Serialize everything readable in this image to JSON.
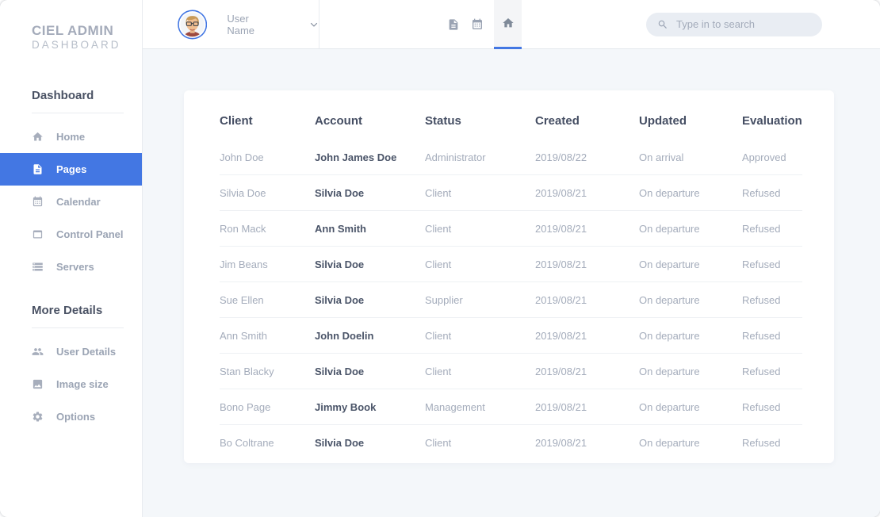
{
  "brand": {
    "line1": "CIEL ADMIN",
    "line2": "DASHBOARD"
  },
  "sidebar": {
    "sections": [
      {
        "heading": "Dashboard",
        "items": [
          {
            "label": "Home",
            "icon": "home-icon",
            "active": false
          },
          {
            "label": "Pages",
            "icon": "pages-icon",
            "active": true
          },
          {
            "label": "Calendar",
            "icon": "calendar-icon",
            "active": false
          },
          {
            "label": "Control Panel",
            "icon": "control-panel-icon",
            "active": false
          },
          {
            "label": "Servers",
            "icon": "servers-icon",
            "active": false
          }
        ]
      },
      {
        "heading": "More Details",
        "items": [
          {
            "label": "User Details",
            "icon": "user-details-icon",
            "active": false
          },
          {
            "label": "Image size",
            "icon": "image-size-icon",
            "active": false
          },
          {
            "label": "Options",
            "icon": "gear-icon",
            "active": false
          }
        ]
      }
    ]
  },
  "topbar": {
    "user": {
      "name": "User Name"
    },
    "tabs": [
      {
        "icon": "document-icon",
        "active": false
      },
      {
        "icon": "calendar-icon",
        "active": false
      },
      {
        "icon": "home-icon",
        "active": true
      }
    ],
    "search": {
      "placeholder": "Type in to search"
    }
  },
  "table": {
    "columns": [
      "Client",
      "Account",
      "Status",
      "Created",
      "Updated",
      "Evaluation"
    ],
    "rows": [
      [
        "John Doe",
        "John James Doe",
        "Administrator",
        "2019/08/22",
        "On arrival",
        "Approved"
      ],
      [
        "Silvia Doe",
        "Silvia Doe",
        "Client",
        "2019/08/21",
        "On departure",
        "Refused"
      ],
      [
        "Ron Mack",
        "Ann Smith",
        "Client",
        "2019/08/21",
        "On departure",
        "Refused"
      ],
      [
        "Jim Beans",
        "Silvia Doe",
        "Client",
        "2019/08/21",
        "On departure",
        "Refused"
      ],
      [
        "Sue Ellen",
        "Silvia Doe",
        "Supplier",
        "2019/08/21",
        "On departure",
        "Refused"
      ],
      [
        "Ann Smith",
        "John Doelin",
        "Client",
        "2019/08/21",
        "On departure",
        "Refused"
      ],
      [
        "Stan Blacky",
        "Silvia Doe",
        "Client",
        "2019/08/21",
        "On departure",
        "Refused"
      ],
      [
        "Bono Page",
        "Jimmy Book",
        "Management",
        "2019/08/21",
        "On departure",
        "Refused"
      ],
      [
        "Bo Coltrane",
        "Silvia Doe",
        "Client",
        "2019/08/21",
        "On departure",
        "Refused"
      ]
    ]
  },
  "colors": {
    "accent": "#4377e3",
    "content_bg": "#f4f7fa",
    "muted_text": "#a4acbb",
    "dark_text": "#4a5468",
    "search_bg": "#e9edf3"
  }
}
